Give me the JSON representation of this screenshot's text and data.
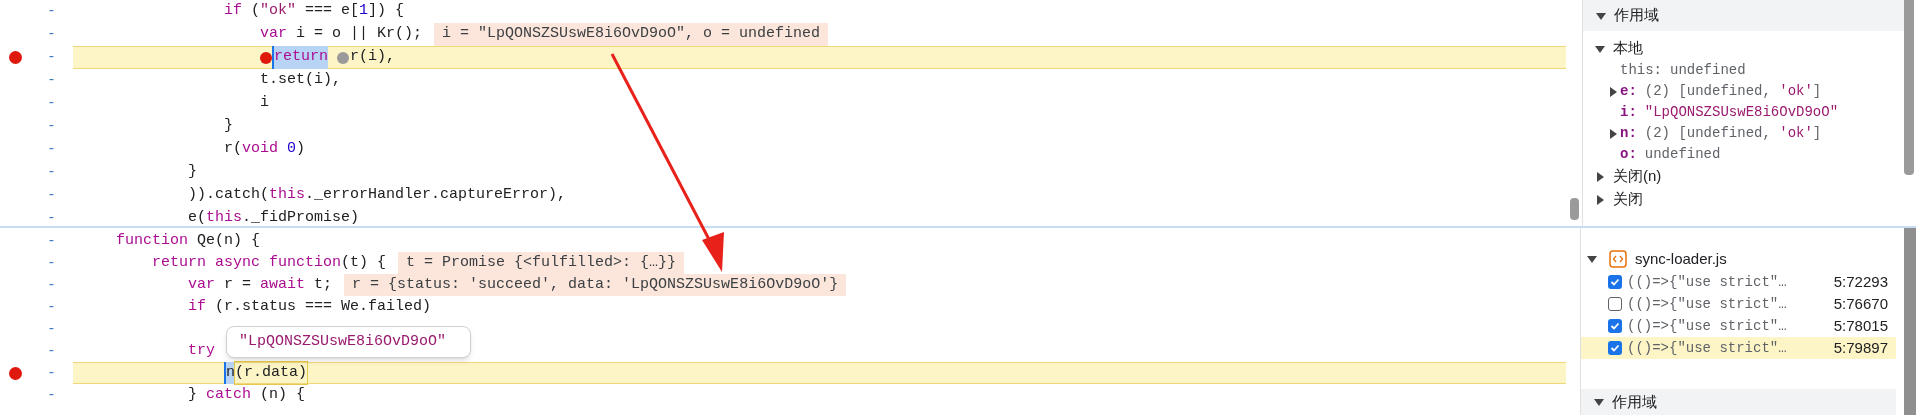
{
  "top_pane": {
    "code_lines": [
      {
        "children": [
          {
            "gutter": "-",
            "breakpoint": false,
            "paused": false,
            "tokens": [
              {
                "kind": "keyword",
                "text": "if"
              },
              {
                "kind": "plain",
                "text": " ("
              },
              {
                "kind": "string",
                "text": "\"ok\""
              },
              {
                "kind": "plain",
                "text": " === e["
              },
              {
                "kind": "number",
                "text": "1"
              },
              {
                "kind": "plain",
                "text": "]) {"
              }
            ],
            "children": [
              {
                "gutter": "-",
                "breakpoint": false,
                "paused": false,
                "tokens": [
                  {
                    "kind": "keyword",
                    "text": "var"
                  },
                  {
                    "kind": "plain",
                    "text": " i = o || Kr();"
                  }
                ],
                "inline_value": "i = \"LpQONSZSUswE8i6OvD9oO\", o = undefined"
              },
              {
                "gutter": "-",
                "breakpoint": true,
                "paused": true,
                "tokens": [
                  {
                    "kind": "marker",
                    "active": true
                  },
                  {
                    "kind": "keyword",
                    "text": "return",
                    "selected": true
                  },
                  {
                    "kind": "marker",
                    "active": false
                  },
                  {
                    "kind": "plain",
                    "text": "r(i),"
                  }
                ]
              },
              {
                "gutter": "-",
                "breakpoint": false,
                "paused": false,
                "tokens": [
                  {
                    "kind": "plain",
                    "text": "t.set(i),"
                  }
                ]
              },
              {
                "gutter": "-",
                "breakpoint": false,
                "paused": false,
                "tokens": [
                  {
                    "kind": "plain",
                    "text": "i"
                  }
                ]
              }
            ]
          },
          {
            "gutter": "-",
            "breakpoint": false,
            "paused": false,
            "tokens": [
              {
                "kind": "plain",
                "text": "}"
              }
            ]
          },
          {
            "gutter": "-",
            "breakpoint": false,
            "paused": false,
            "tokens": [
              {
                "kind": "plain",
                "text": "r("
              },
              {
                "kind": "keyword",
                "text": "void"
              },
              {
                "kind": "number",
                "text": " 0"
              },
              {
                "kind": "plain",
                "text": ")"
              }
            ]
          }
        ]
      },
      {
        "gutter": "-",
        "breakpoint": false,
        "paused": false,
        "tokens": [
          {
            "kind": "plain",
            "text": "}"
          }
        ]
      },
      {
        "gutter": "-",
        "breakpoint": false,
        "paused": false,
        "tokens": [
          {
            "kind": "plain",
            "text": ")).catch("
          },
          {
            "kind": "keyword",
            "text": "this"
          },
          {
            "kind": "plain",
            "text": "._errorHandler.captureError),"
          }
        ]
      },
      {
        "gutter": "-",
        "breakpoint": false,
        "paused": false,
        "tokens": [
          {
            "kind": "plain",
            "text": "e("
          },
          {
            "kind": "keyword",
            "text": "this"
          },
          {
            "kind": "plain",
            "text": "._fidPromise)"
          }
        ]
      }
    ],
    "scope": {
      "title": "作用域",
      "expanded": true,
      "items": [
        {
          "label": "本地",
          "expanded": true,
          "children": [
            {
              "kind": "receiver",
              "key": "this:",
              "expandable": false,
              "value": [
                {
                  "kind": "plain",
                  "text": "undefined"
                }
              ]
            },
            {
              "kind": "property",
              "key": "e:",
              "expandable": true,
              "value": [
                {
                  "kind": "plain",
                  "text": "(2) [undefined, "
                },
                {
                  "kind": "string",
                  "text": "'ok'"
                },
                {
                  "kind": "plain",
                  "text": "]"
                }
              ]
            },
            {
              "kind": "property",
              "key": "i:",
              "expandable": false,
              "value": [
                {
                  "kind": "string",
                  "text": "\"LpQONSZSUswE8i6OvD9oO\""
                }
              ]
            },
            {
              "kind": "property",
              "key": "n:",
              "expandable": true,
              "value": [
                {
                  "kind": "plain",
                  "text": "(2) [undefined, "
                },
                {
                  "kind": "string",
                  "text": "'ok'"
                },
                {
                  "kind": "plain",
                  "text": "]"
                }
              ]
            },
            {
              "kind": "property",
              "key": "o:",
              "expandable": false,
              "value": [
                {
                  "kind": "plain",
                  "text": "undefined"
                }
              ]
            }
          ]
        },
        {
          "label": "关闭(n)",
          "expanded": false
        },
        {
          "label": "关闭",
          "expanded": false
        }
      ]
    }
  },
  "bottom_pane": {
    "code_lines": [
      {
        "gutter": "-",
        "breakpoint": false,
        "paused": false,
        "tokens": [
          {
            "kind": "keyword",
            "text": "function"
          },
          {
            "kind": "plain",
            "text": " Qe(n) {"
          }
        ],
        "children": [
          {
            "gutter": "-",
            "breakpoint": false,
            "paused": false,
            "tokens": [
              {
                "kind": "keyword",
                "text": "return async function"
              },
              {
                "kind": "plain",
                "text": "(t) {"
              }
            ],
            "inline_value": "t = Promise {<fulfilled>: {…}}",
            "children": [
              {
                "gutter": "-",
                "breakpoint": false,
                "paused": false,
                "tokens": [
                  {
                    "kind": "keyword",
                    "text": "var"
                  },
                  {
                    "kind": "plain",
                    "text": " r = "
                  },
                  {
                    "kind": "keyword",
                    "text": "await"
                  },
                  {
                    "kind": "plain",
                    "text": " t;"
                  }
                ],
                "inline_value": "r = {status: 'succeed', data: 'LpQONSZSUswE8i6OvD9oO'}"
              },
              {
                "gutter": "-",
                "breakpoint": false,
                "paused": false,
                "tokens": [
                  {
                    "kind": "keyword",
                    "text": "if"
                  },
                  {
                    "kind": "plain",
                    "text": " (r.status === We.failed)"
                  }
                ],
                "children": [
                  {
                    "gutter": "-",
                    "breakpoint": false,
                    "paused": false
                  }
                ]
              },
              {
                "gutter": "-",
                "breakpoint": false,
                "paused": false,
                "tokens": [
                  {
                    "kind": "keyword",
                    "text": "try"
                  }
                ],
                "children": [
                  {
                    "gutter": "-",
                    "breakpoint": true,
                    "paused": true,
                    "tokens": [
                      {
                        "kind": "plain",
                        "text": "n",
                        "selected": true
                      },
                      {
                        "kind": "plain",
                        "text": "(r.data)",
                        "outlined": true
                      }
                    ]
                  }
                ]
              },
              {
                "gutter": "-",
                "breakpoint": false,
                "paused": false,
                "tokens": [
                  {
                    "kind": "plain",
                    "text": "} "
                  },
                  {
                    "kind": "keyword",
                    "text": "catch"
                  },
                  {
                    "kind": "plain",
                    "text": " (n) {"
                  }
                ]
              }
            ]
          }
        ]
      }
    ],
    "hover_popup": {
      "value": "\"LpQONSZSUswE8i6OvD9oO\""
    },
    "breakpoints": {
      "file": "sync-loader.js",
      "expanded": true,
      "items": [
        {
          "code": "(()=>{\"use strict\"…",
          "location": "5:72293",
          "checked": true,
          "selected": false
        },
        {
          "code": "(()=>{\"use strict\"…",
          "location": "5:76670",
          "checked": false,
          "selected": false
        },
        {
          "code": "(()=>{\"use strict\"…",
          "location": "5:78015",
          "checked": true,
          "selected": false
        },
        {
          "code": "(()=>{\"use strict\"…",
          "location": "5:79897",
          "checked": true,
          "selected": true
        }
      ]
    },
    "scope_header": {
      "title": "作用域",
      "expanded": true
    }
  }
}
